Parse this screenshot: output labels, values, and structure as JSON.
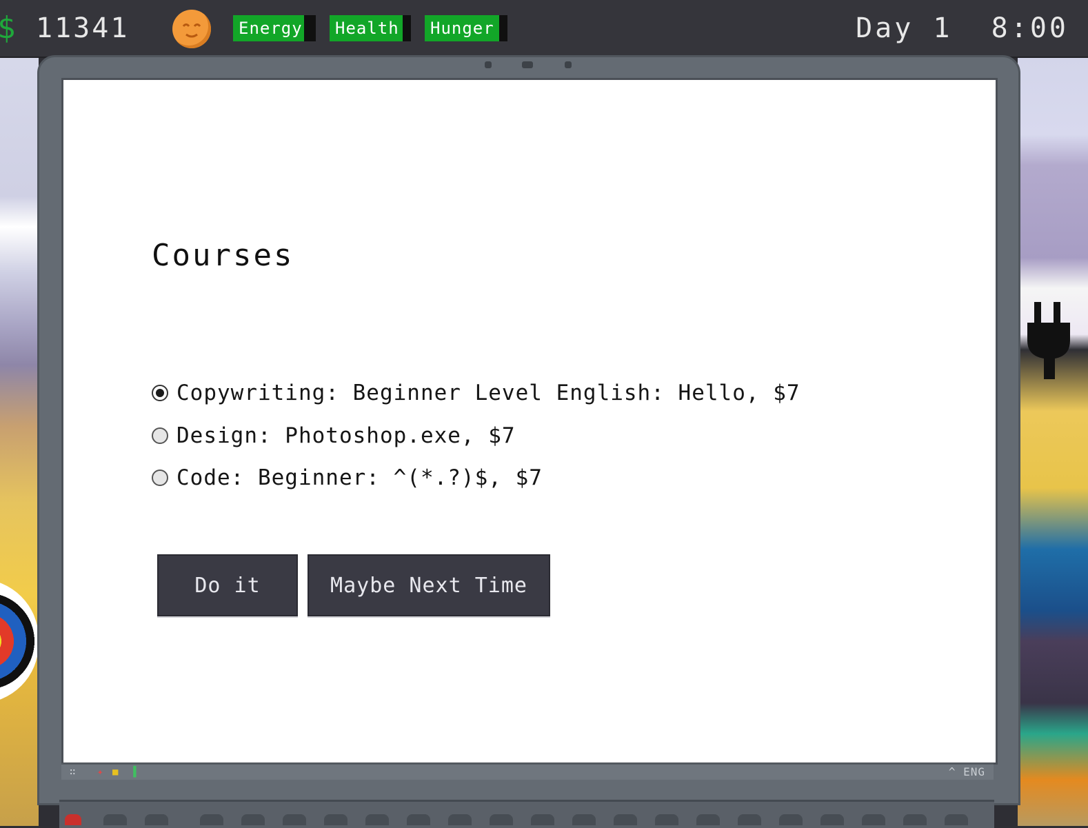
{
  "hud": {
    "currency_symbol": "$",
    "money": "11341",
    "mood_icon": "smiling-face-icon",
    "stats": [
      {
        "label": "Energy",
        "level": 0.86,
        "color": "#12a628"
      },
      {
        "label": "Health",
        "level": 0.9,
        "color": "#12a628"
      },
      {
        "label": "Hunger",
        "level": 0.9,
        "color": "#12a628"
      }
    ],
    "day_time": "Day 1  8:00"
  },
  "window": {
    "title": "Courses",
    "options": [
      {
        "label": "Copywriting: Beginner Level English: Hello, $7",
        "selected": true
      },
      {
        "label": "Design: Photoshop.exe, $7",
        "selected": false
      },
      {
        "label": "Code: Beginner: ^(*.?)$, $7",
        "selected": false
      }
    ],
    "buttons": {
      "confirm": "Do it",
      "dismiss": "Maybe Next Time"
    }
  },
  "taskbar": {
    "tray_text": "^ ENG"
  }
}
